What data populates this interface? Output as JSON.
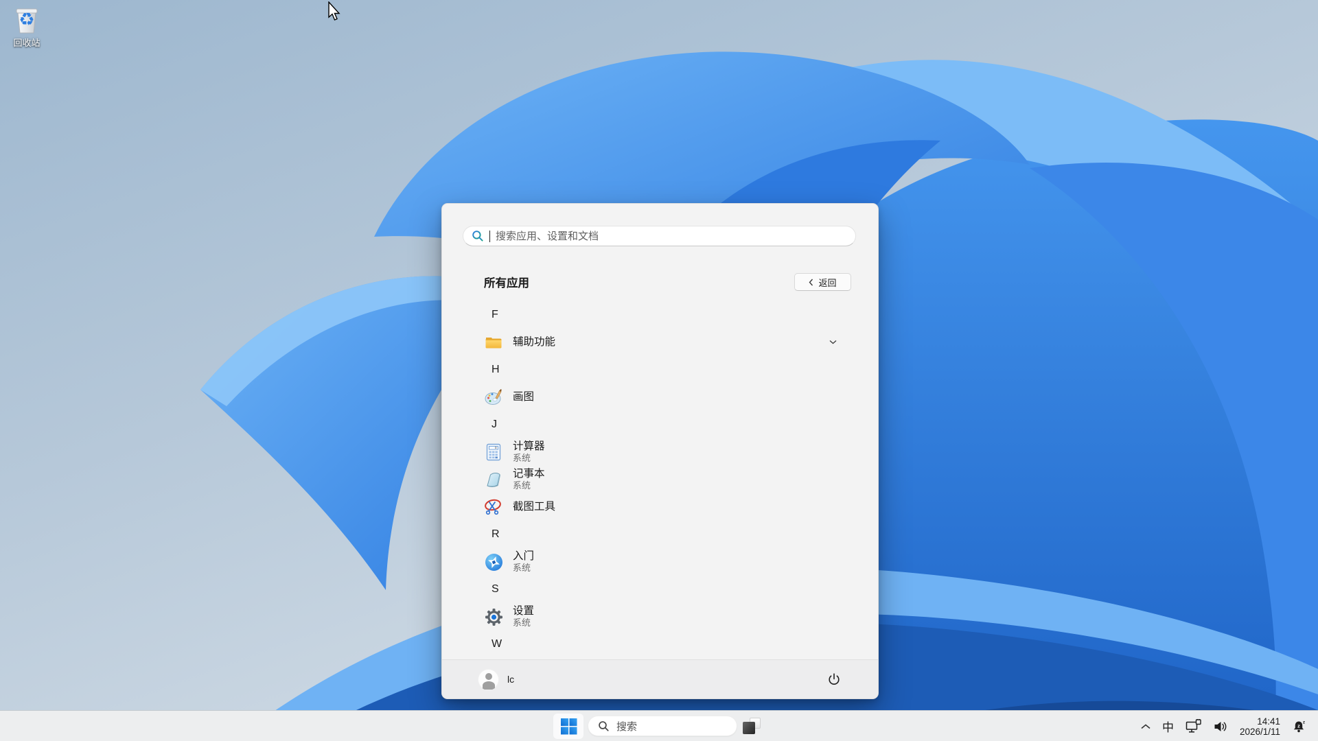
{
  "desktop": {
    "recycle_bin_label": "回收站"
  },
  "start_menu": {
    "search_placeholder": "搜索应用、设置和文档",
    "all_apps_title": "所有应用",
    "back_label": "返回",
    "app_list": [
      {
        "type": "letter",
        "label": "F"
      },
      {
        "type": "folder",
        "label": "辅助功能",
        "icon": "folder",
        "expandable": true
      },
      {
        "type": "letter",
        "label": "H"
      },
      {
        "type": "app",
        "label": "画图",
        "icon": "paint"
      },
      {
        "type": "letter",
        "label": "J"
      },
      {
        "type": "app",
        "label": "计算器",
        "sublabel": "系统",
        "icon": "calculator"
      },
      {
        "type": "app",
        "label": "记事本",
        "sublabel": "系统",
        "icon": "notepad"
      },
      {
        "type": "app",
        "label": "截图工具",
        "icon": "snipping"
      },
      {
        "type": "letter",
        "label": "R"
      },
      {
        "type": "app",
        "label": "入门",
        "sublabel": "系统",
        "icon": "getstarted"
      },
      {
        "type": "letter",
        "label": "S"
      },
      {
        "type": "app",
        "label": "设置",
        "sublabel": "系统",
        "icon": "settings"
      },
      {
        "type": "letter",
        "label": "W"
      }
    ],
    "user_name": "lc"
  },
  "taskbar": {
    "search_label": "搜索",
    "tray": {
      "ime_label": "中",
      "time": "14:41",
      "date": "2026/1/11"
    }
  },
  "icons": {
    "recycle_symbol": "♻",
    "menu_search": "magnifier",
    "back_chevron": "chevron-left",
    "folder_expand": "chevron-down",
    "tray_overflow": "chevron-up",
    "network": "ethernet-monitor",
    "volume": "speaker",
    "notifications": "bell-do-not-disturb",
    "power": "power-symbol"
  },
  "colors": {
    "accent_blue": "#1f6fd6",
    "folder_yellow": "#f5bd4a",
    "menu_bg": "#f3f3f3",
    "taskbar_bg": "#edeeef",
    "search_icon_gradient": [
      "#2f7de1",
      "#18a28b"
    ]
  }
}
